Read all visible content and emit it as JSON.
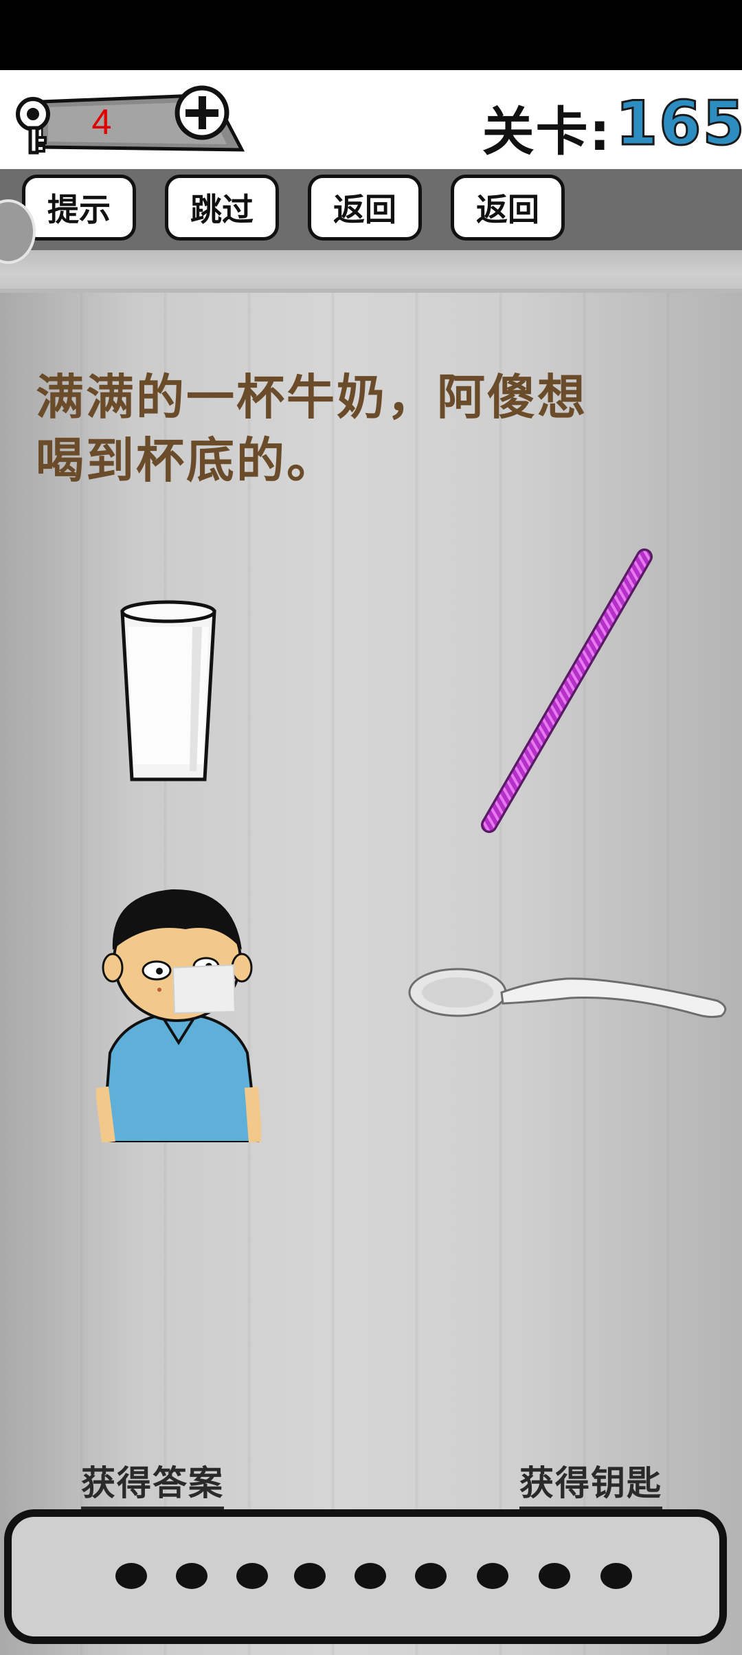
{
  "header": {
    "key_count": "4",
    "level_label": "关卡:",
    "level_number": "165"
  },
  "toolbar": {
    "hint_label": "提示",
    "skip_label": "跳过",
    "back_label_1": "返回",
    "back_label_2": "返回"
  },
  "question": {
    "line1": "满满的一杯牛奶，阿傻想",
    "line2": "喝到杯底的。"
  },
  "items": [
    "glass-of-milk-icon",
    "straw-icon",
    "boy-icon",
    "spoon-icon"
  ],
  "footer": {
    "get_answer_label": "获得答案",
    "get_key_label": "获得钥匙",
    "answer_slots": 9
  },
  "colors": {
    "level_number": "#2d8cc0",
    "key_count": "#e00000",
    "question_text": "#6b4c2a",
    "straw": "#c23ad0"
  }
}
